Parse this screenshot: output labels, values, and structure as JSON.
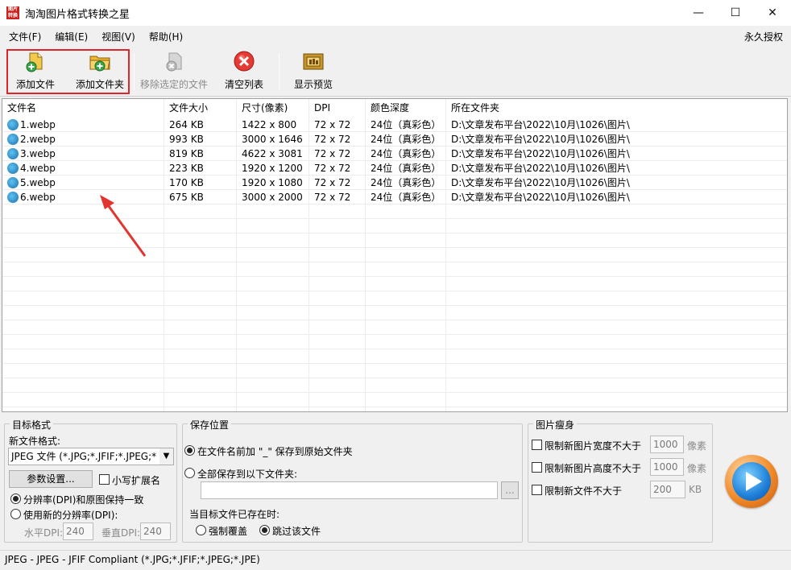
{
  "window": {
    "title": "淘淘图片格式转换之星",
    "app_icon_text": "图片转换",
    "controls": [
      "—",
      "☐",
      "✕"
    ]
  },
  "menu": {
    "items": [
      "文件(F)",
      "编辑(E)",
      "视图(V)",
      "帮助(H)"
    ],
    "right": "永久授权"
  },
  "toolbar": {
    "add_file": "添加文件",
    "add_folder": "添加文件夹",
    "remove_selected": "移除选定的文件",
    "clear_list": "清空列表",
    "show_preview": "显示预览"
  },
  "filelist": {
    "columns": [
      "文件名",
      "文件大小",
      "尺寸(像素)",
      "DPI",
      "颜色深度",
      "所在文件夹"
    ],
    "rows": [
      [
        "1.webp",
        "264 KB",
        "1422 x 800",
        "72 x 72",
        "24位（真彩色）",
        "D:\\文章发布平台\\2022\\10月\\1026\\图片\\"
      ],
      [
        "2.webp",
        "993 KB",
        "3000 x 1646",
        "72 x 72",
        "24位（真彩色）",
        "D:\\文章发布平台\\2022\\10月\\1026\\图片\\"
      ],
      [
        "3.webp",
        "819 KB",
        "4622 x 3081",
        "72 x 72",
        "24位（真彩色）",
        "D:\\文章发布平台\\2022\\10月\\1026\\图片\\"
      ],
      [
        "4.webp",
        "223 KB",
        "1920 x 1200",
        "72 x 72",
        "24位（真彩色）",
        "D:\\文章发布平台\\2022\\10月\\1026\\图片\\"
      ],
      [
        "5.webp",
        "170 KB",
        "1920 x 1080",
        "72 x 72",
        "24位（真彩色）",
        "D:\\文章发布平台\\2022\\10月\\1026\\图片\\"
      ],
      [
        "6.webp",
        "675 KB",
        "3000 x 2000",
        "72 x 72",
        "24位（真彩色）",
        "D:\\文章发布平台\\2022\\10月\\1026\\图片\\"
      ]
    ]
  },
  "target_format": {
    "title": "目标格式",
    "new_format_label": "新文件格式:",
    "format_value": "JPEG 文件 (*.JPG;*.JFIF;*.JPEG;*",
    "params_button": "参数设置...",
    "lowercase_ext": "小写扩展名",
    "keep_dpi": "分辨率(DPI)和原图保持一致",
    "new_dpi": "使用新的分辨率(DPI):",
    "h_dpi_label": "水平DPI:",
    "h_dpi_value": "240",
    "v_dpi_label": "垂直DPI:",
    "v_dpi_value": "240"
  },
  "save_location": {
    "title": "保存位置",
    "option_prefix": "在文件名前加 \"_\" 保存到原始文件夹",
    "option_folder": "全部保存到以下文件夹:",
    "folder_value": "",
    "browse": "...",
    "exists_label": "当目标文件已存在时:",
    "overwrite": "强制覆盖",
    "skip": "跳过该文件"
  },
  "slim": {
    "title": "图片瘦身",
    "limit_width": "限制新图片宽度不大于",
    "width_value": "1000",
    "width_unit": "像素",
    "limit_height": "限制新图片高度不大于",
    "height_value": "1000",
    "height_unit": "像素",
    "limit_size": "限制新文件不大于",
    "size_value": "200",
    "size_unit": "KB"
  },
  "status": {
    "text": "JPEG - JPEG - JFIF Compliant (*.JPG;*.JFIF;*.JPEG;*.JPE)"
  }
}
